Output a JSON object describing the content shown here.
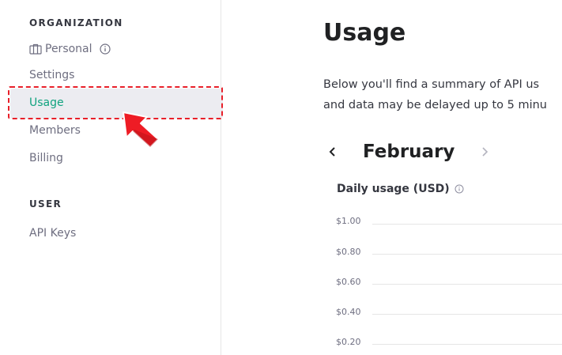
{
  "sidebar": {
    "org_title": "ORGANIZATION",
    "org_name": "Personal",
    "items": [
      {
        "label": "Settings"
      },
      {
        "label": "Usage"
      },
      {
        "label": "Members"
      },
      {
        "label": "Billing"
      }
    ],
    "user_title": "USER",
    "user_items": [
      {
        "label": "API Keys"
      }
    ],
    "active_item": "Usage",
    "accent": "#10a37f",
    "highlight": "#e8202a"
  },
  "main": {
    "title": "Usage",
    "description_line1": "Below you'll find a summary of API us",
    "description_line2": "and data may be delayed up to 5 minu",
    "month": "February",
    "chart_title": "Daily usage (USD)",
    "y_ticks": [
      "$1.00",
      "$0.80",
      "$0.60",
      "$0.40",
      "$0.20"
    ]
  },
  "icons": {
    "personal": "briefcase-icon",
    "info": "info-icon",
    "prev": "chevron-left-icon",
    "next": "chevron-right-icon"
  }
}
